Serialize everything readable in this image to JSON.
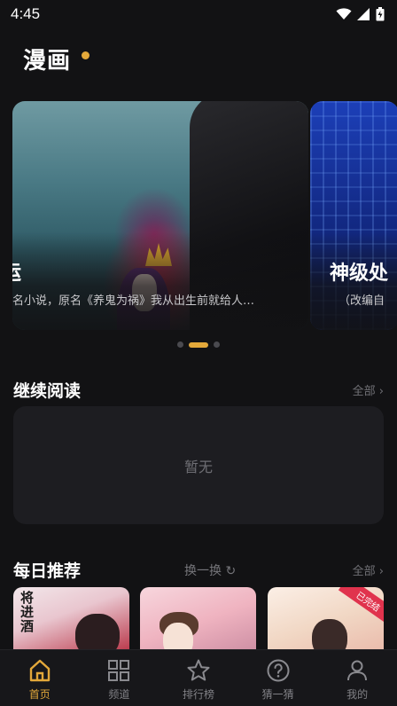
{
  "status_bar": {
    "time": "4:45"
  },
  "header": {
    "title": "漫画"
  },
  "colors": {
    "accent": "#e3a83a",
    "background": "#121214",
    "card": "#1d1d21"
  },
  "banner": {
    "items": [
      {
        "title": "运",
        "desc": "名小说，原名《养鬼为祸》我从出生前就给人…"
      },
      {
        "title": "神级处",
        "desc": "（改编自"
      }
    ],
    "active_index": 1,
    "dot_count": 3
  },
  "continue_reading": {
    "title": "继续阅读",
    "more": "全部 ›",
    "empty_text": "暂无"
  },
  "daily_recommend": {
    "title": "每日推荐",
    "refresh_label": "换一换 ↻",
    "more": "全部 ›",
    "cards": [
      {
        "calligraphy": "将进酒"
      },
      {
        "calligraphy": ""
      },
      {
        "tag": "已完结"
      }
    ]
  },
  "tabbar": {
    "items": [
      {
        "label": "首页",
        "icon": "home-icon",
        "active": true
      },
      {
        "label": "频道",
        "icon": "grid-icon",
        "active": false
      },
      {
        "label": "排行榜",
        "icon": "star-icon",
        "active": false
      },
      {
        "label": "猜一猜",
        "icon": "question-icon",
        "active": false
      },
      {
        "label": "我的",
        "icon": "user-icon",
        "active": false
      }
    ]
  }
}
